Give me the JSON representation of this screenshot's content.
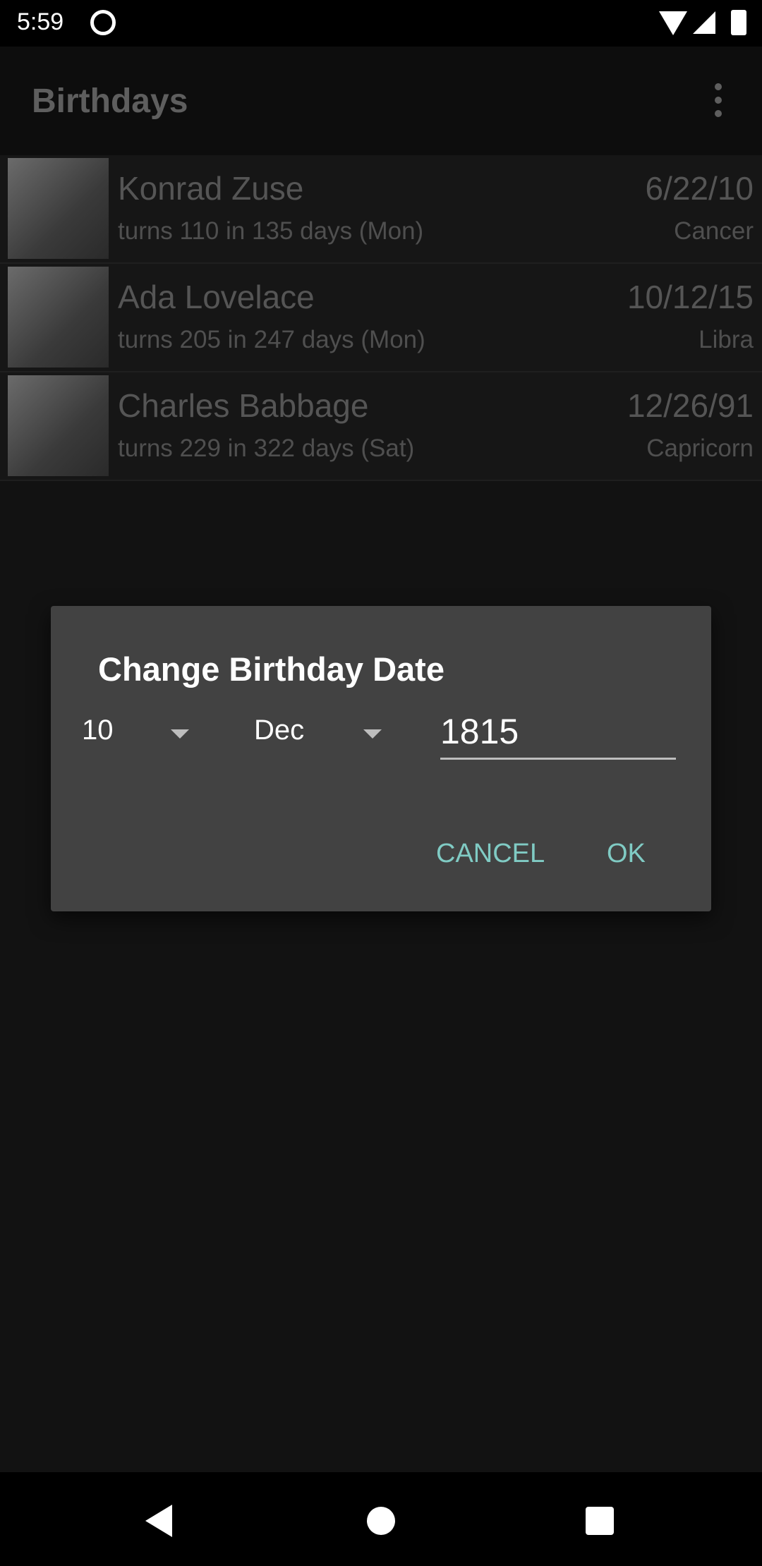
{
  "status": {
    "time": "5:59"
  },
  "appbar": {
    "title": "Birthdays"
  },
  "people": [
    {
      "name": "Konrad Zuse",
      "sub": "turns 110 in 135 days (Mon)",
      "date": "6/22/10",
      "sign": "Cancer"
    },
    {
      "name": "Ada Lovelace",
      "sub": "turns 205 in 247 days (Mon)",
      "date": "10/12/15",
      "sign": "Libra"
    },
    {
      "name": "Charles Babbage",
      "sub": "turns 229 in 322 days (Sat)",
      "date": "12/26/91",
      "sign": "Capricorn"
    }
  ],
  "dialog": {
    "title": "Change Birthday Date",
    "day": "10",
    "month": "Dec",
    "year": "1815",
    "cancel": "CANCEL",
    "ok": "OK"
  }
}
